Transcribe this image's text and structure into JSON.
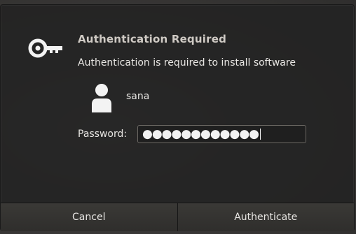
{
  "dialog": {
    "title": "Authentication Required",
    "message": "Authentication is required to install software",
    "icons": {
      "main": "key-icon",
      "user": "user-icon"
    }
  },
  "user": {
    "name": "sana"
  },
  "password": {
    "label": "Password:",
    "masked_value": "●●●●●●●●●●●●"
  },
  "buttons": {
    "cancel": "Cancel",
    "authenticate": "Authenticate"
  }
}
